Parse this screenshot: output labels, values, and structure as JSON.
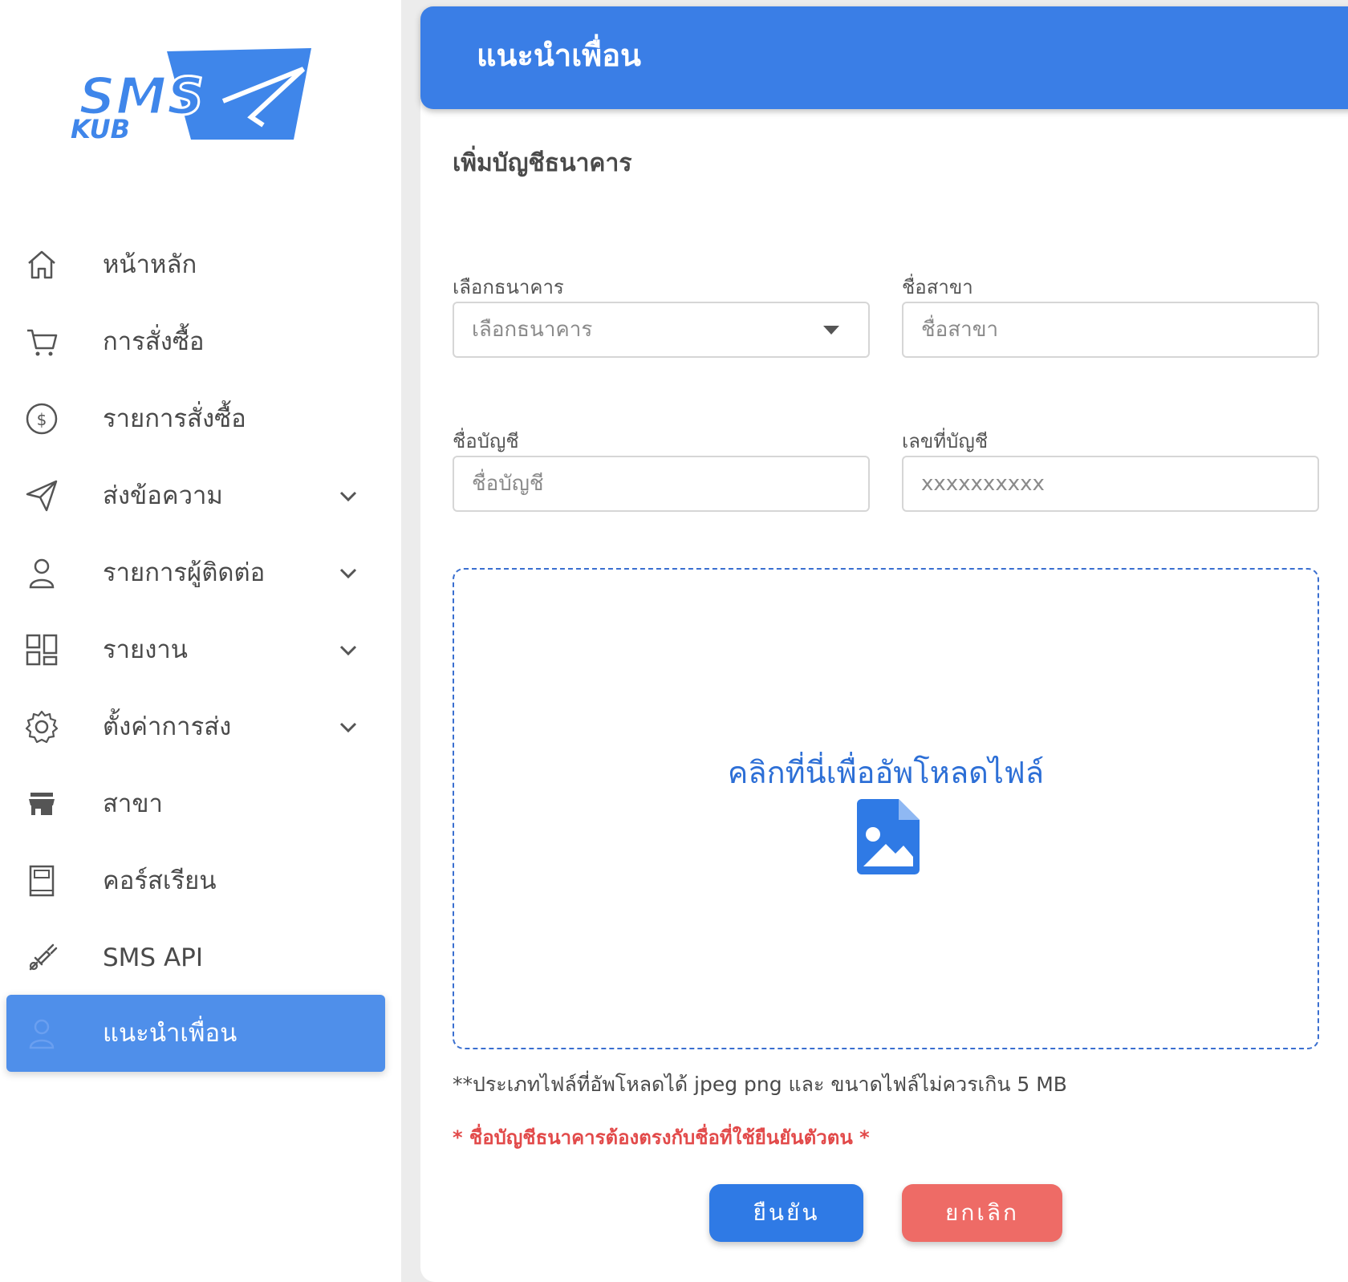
{
  "brand": {
    "logo_text_top": "SMS",
    "logo_text_bottom": "KUB"
  },
  "sidebar": {
    "items": [
      {
        "label": "หน้าหลัก",
        "icon": "home-icon",
        "expandable": false
      },
      {
        "label": "การสั่งซื้อ",
        "icon": "cart-icon",
        "expandable": false
      },
      {
        "label": "รายการสั่งซื้อ",
        "icon": "dollar-circle-icon",
        "expandable": false
      },
      {
        "label": "ส่งข้อความ",
        "icon": "send-icon",
        "expandable": true
      },
      {
        "label": "รายการผู้ติดต่อ",
        "icon": "user-icon",
        "expandable": true
      },
      {
        "label": "รายงาน",
        "icon": "dashboard-icon",
        "expandable": true
      },
      {
        "label": "ตั้งค่าการส่ง",
        "icon": "gear-icon",
        "expandable": true
      },
      {
        "label": "สาขา",
        "icon": "store-icon",
        "expandable": false
      },
      {
        "label": "คอร์สเรียน",
        "icon": "book-icon",
        "expandable": false
      },
      {
        "label": "SMS API",
        "icon": "plug-icon",
        "expandable": false
      },
      {
        "label": "แนะนำเพื่อน",
        "icon": "user-icon",
        "expandable": false,
        "active": true
      }
    ]
  },
  "header": {
    "title": "แนะนำเพื่อน"
  },
  "form": {
    "section_title": "เพิ่มบัญชีธนาคาร",
    "bank": {
      "label": "เลือกธนาคาร",
      "placeholder": "เลือกธนาคาร"
    },
    "branch": {
      "label": "ชื่อสาขา",
      "placeholder": "ชื่อสาขา"
    },
    "account_name": {
      "label": "ชื่อบัญชี",
      "placeholder": "ชื่อบัญชี"
    },
    "account_number": {
      "label": "เลขที่บัญชี",
      "placeholder": "xxxxxxxxxx"
    },
    "upload": {
      "text": "คลิกที่นี่เพื่ออัพโหลดไฟล์",
      "icon": "image-file-icon"
    },
    "note": "**ประเภทไฟล์ที่อัพโหลดได้ jpeg png และ ขนาดไฟล์ไม่ควรเกิน 5 MB",
    "warning": "* ชื่อบัญชีธนาคารต้องตรงกับชื่อที่ใช้ยืนยันตัวตน *",
    "confirm_label": "ยืนยัน",
    "cancel_label": "ยกเลิก"
  },
  "colors": {
    "primary": "#3a7ee6",
    "sidebar_active": "#4f8fea",
    "danger": "#ee6b66",
    "warning_text": "#e24a4a"
  }
}
